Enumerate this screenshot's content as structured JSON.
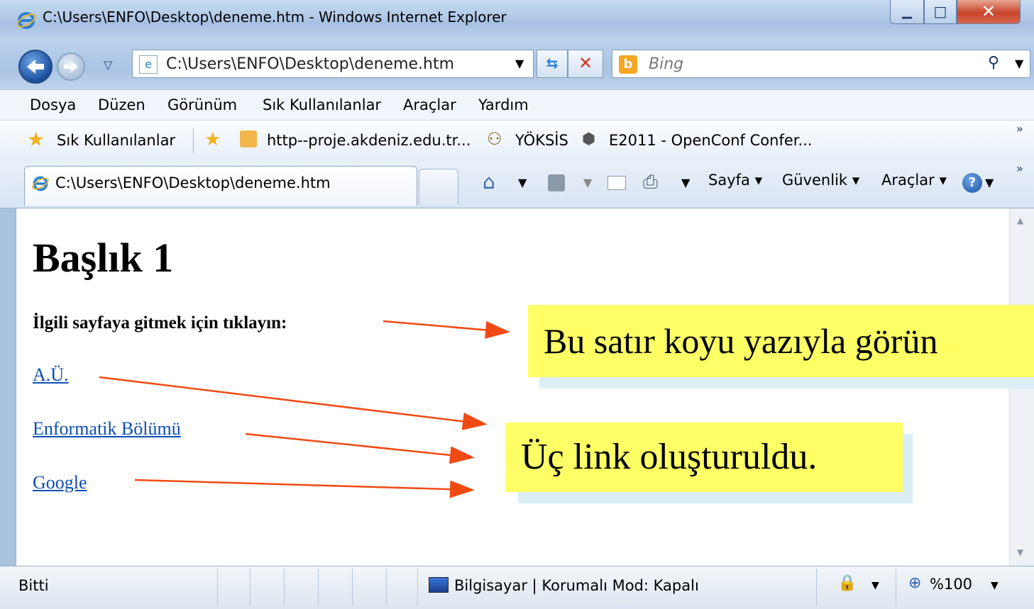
{
  "window": {
    "title": "C:\\Users\\ENFO\\Desktop\\deneme.htm - Windows Internet Explorer"
  },
  "nav": {
    "address": "C:\\Users\\ENFO\\Desktop\\deneme.htm",
    "search_placeholder": "Bing"
  },
  "menubar": {
    "items": [
      "Dosya",
      "Düzen",
      "Görünüm",
      "Sık Kullanılanlar",
      "Araçlar",
      "Yardım"
    ]
  },
  "favorites": {
    "label": "Sık Kullanılanlar",
    "links": [
      "http--proje.akdeniz.edu.tr...",
      "YÖKSİS",
      "E2011 - OpenConf Confer..."
    ]
  },
  "tab": {
    "title": "C:\\Users\\ENFO\\Desktop\\deneme.htm"
  },
  "commandbar": {
    "page": "Sayfa",
    "safety": "Güvenlik",
    "tools": "Araçlar"
  },
  "page": {
    "heading": "Başlık 1",
    "intro": "İlgili sayfaya gitmek için tıklayın:",
    "links": [
      "A.Ü.",
      "Enformatik Bölümü",
      "Google"
    ]
  },
  "callouts": {
    "bold_note": "Bu satır koyu yazıyla görün",
    "links_note": "Üç link oluşturuldu."
  },
  "statusbar": {
    "status": "Bitti",
    "zone": "Bilgisayar | Korumalı Mod: Kapalı",
    "zoom": "%100"
  },
  "colors": {
    "link": "#0b4eb3",
    "callout": "#ffff66",
    "arrow": "#f04a14"
  }
}
